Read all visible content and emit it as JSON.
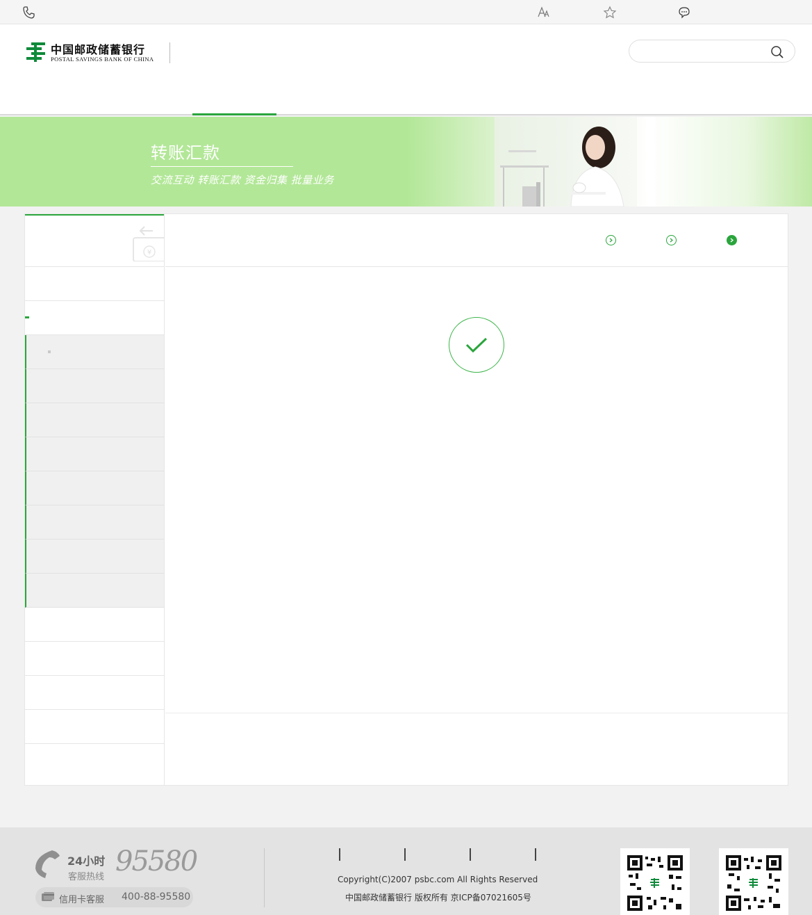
{
  "topbar": {
    "icons": [
      "phone-icon",
      "font-size-icon",
      "star-icon",
      "chat-icon"
    ]
  },
  "header": {
    "logo_cn": "中国邮政储蓄银行",
    "logo_en": "POSTAL SAVINGS BANK OF CHINA",
    "search_placeholder": "",
    "search_value": ""
  },
  "banner": {
    "title": "转账汇款",
    "subtitle": "交流互动 转账汇款 资金归集 批量业务"
  },
  "sidebar": {
    "items": [
      "",
      "",
      "",
      "",
      "",
      "",
      "",
      "",
      "",
      "",
      "",
      "",
      "",
      ""
    ]
  },
  "steps": {
    "current": 3,
    "total": 3
  },
  "result": {
    "status_icon": "check-circle-icon"
  },
  "footer": {
    "hotline_24": "24小时",
    "hotline_sub": "客服热线",
    "hotline_number": "95580",
    "card_label": "信用卡客服",
    "card_number": "400-88-95580",
    "copyright": "Copyright(C)2007 psbc.com    All Rights Reserved",
    "icp": "中国邮政储蓄银行 版权所有 京ICP备07021605号"
  },
  "colors": {
    "brand_green": "#2aa53c",
    "banner_green": "#b2e797",
    "success_green": "#3db54a"
  }
}
